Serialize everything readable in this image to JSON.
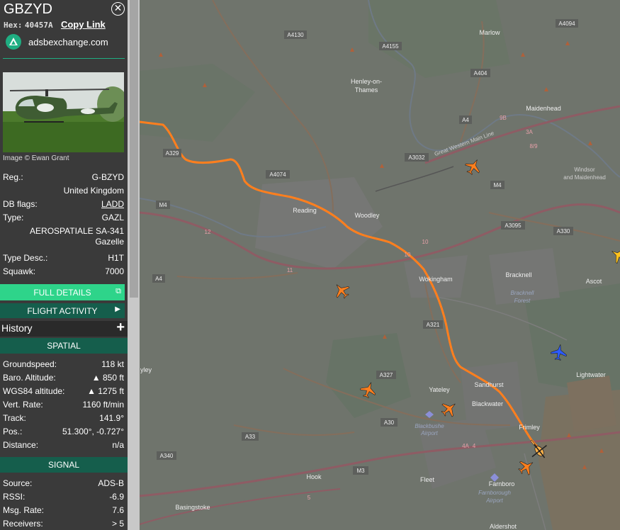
{
  "aircraft": {
    "callsign": "GBZYD",
    "hex_label": "Hex:",
    "hex": "40457A",
    "copy_link": "Copy Link",
    "site": "adsbexchange.com",
    "image_credit": "Image © Ewan Grant"
  },
  "details": {
    "reg_label": "Reg.:",
    "reg": "G-BZYD",
    "country": "United Kingdom",
    "db_flags_label": "DB flags:",
    "db_flags": "LADD",
    "type_label": "Type:",
    "type": "GAZL",
    "type_full": "AEROSPATIALE SA-341",
    "type_full2": "Gazelle",
    "type_desc_label": "Type Desc.:",
    "type_desc": "H1T",
    "squawk_label": "Squawk:",
    "squawk": "7000"
  },
  "buttons": {
    "full_details": "FULL DETAILS",
    "flight_activity": "FLIGHT ACTIVITY",
    "history": "History"
  },
  "spatial": {
    "heading": "SPATIAL",
    "groundspeed_label": "Groundspeed:",
    "groundspeed": "118 kt",
    "baro_label": "Baro. Altitude:",
    "baro": "▲ 850 ft",
    "wgs_label": "WGS84 altitude:",
    "wgs": "▲ 1275 ft",
    "vrate_label": "Vert. Rate:",
    "vrate": "1160 ft/min",
    "track_label": "Track:",
    "track": "141.9°",
    "pos_label": "Pos.:",
    "pos": "51.300°, -0.727°",
    "distance_label": "Distance:",
    "distance": "n/a"
  },
  "signal": {
    "heading": "SIGNAL",
    "source_label": "Source:",
    "source": "ADS-B",
    "rssi_label": "RSSI:",
    "rssi": "-6.9",
    "msgrate_label": "Msg. Rate:",
    "msgrate": "7.6",
    "receivers_label": "Receivers:",
    "receivers": "> 5"
  },
  "map_labels": {
    "marlow": "Marlow",
    "henley": "Henley-on-",
    "henley2": "Thames",
    "maidenhead": "Maidenhead",
    "windsor": "Windsor",
    "windsor2": "and Maidenhead",
    "reading": "Reading",
    "woodley": "Woodley",
    "wokingham": "Wokingham",
    "bracknell": "Bracknell",
    "bracknell_forest": "Bracknell",
    "bracknell_forest2": "Forest",
    "ascot": "Ascot",
    "sandhurst": "Sandhurst",
    "yateley": "Yateley",
    "blackwater": "Blackwater",
    "frimley": "Frimley",
    "lightwater": "Lightwater",
    "blackbushe": "Blackbushe",
    "blackbushe2": "Airport",
    "farnborough": "Farnboro",
    "farnborough_airport": "Farnborough",
    "farnborough_airport2": "Airport",
    "fleet": "Fleet",
    "hook": "Hook",
    "basingstoke": "Basingstoke",
    "aldershot": "Aldershot",
    "yley": "yley",
    "gwml": "Great Western Main Line",
    "a4130": "A4130",
    "a4155": "A4155",
    "a4094": "A4094",
    "a404": "A404",
    "a4": "A4",
    "a4_left": "A4",
    "a3032": "A3032",
    "a4074": "A4074",
    "a329": "A329",
    "m4_left": "M4",
    "m4_right": "M4",
    "a3095": "A3095",
    "a330": "A330",
    "a321": "A321",
    "a327": "A327",
    "a30": "A30",
    "a33": "A33",
    "a340": "A340",
    "m3": "M3",
    "j12": "12",
    "j11": "11",
    "j10": "10",
    "j10b": "10",
    "j9b": "9B",
    "j8_9": "8/9",
    "j3a": "3A",
    "j4a": "4A",
    "j4": "4",
    "j5": "5"
  },
  "colors": {
    "accent_green": "#1fae82",
    "full_details_bg": "#2ed48a",
    "section_bg": "#155e4c",
    "track_color": "#ff7f1e",
    "aircraft_orange": "#ff7f1e",
    "aircraft_blue": "#2c5bff",
    "aircraft_yellow": "#ffc21e"
  }
}
